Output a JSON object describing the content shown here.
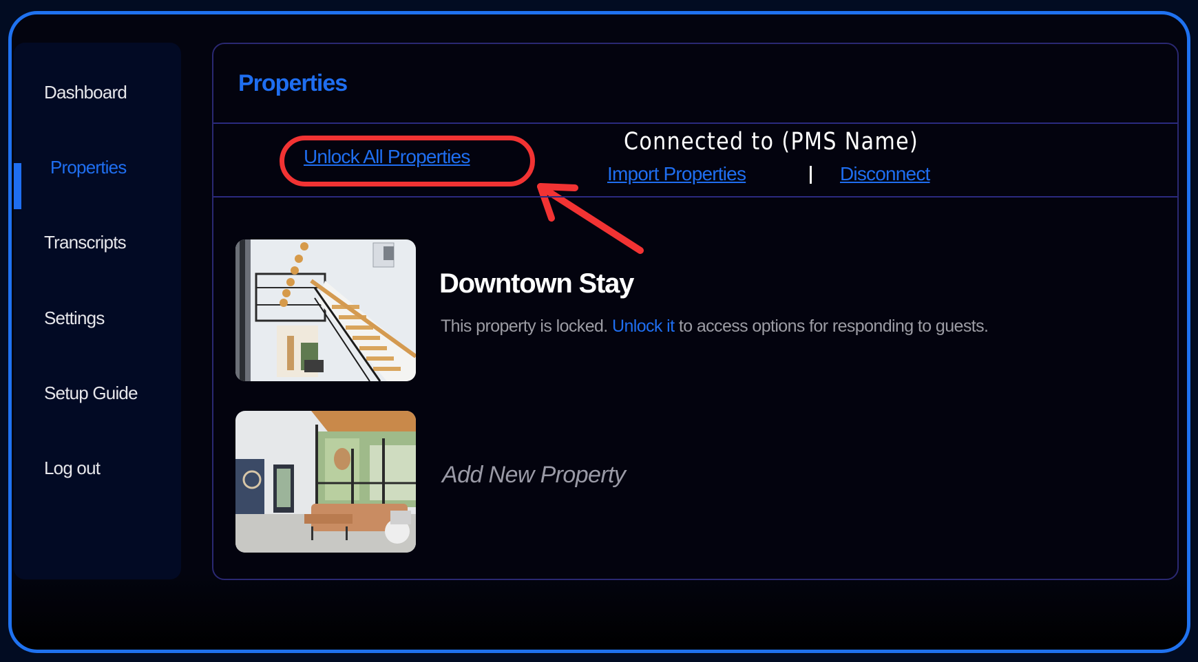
{
  "sidebar": {
    "items": [
      {
        "label": "Dashboard",
        "active": false
      },
      {
        "label": "Properties",
        "active": true
      },
      {
        "label": "Transcripts",
        "active": false
      },
      {
        "label": "Settings",
        "active": false
      },
      {
        "label": "Setup Guide",
        "active": false
      },
      {
        "label": "Log out",
        "active": false
      }
    ]
  },
  "main": {
    "title": "Properties",
    "toolbar": {
      "unlock_all_label": "Unlock All Properties",
      "connection_status": "Connected to (PMS Name)",
      "import_label": "Import Properties",
      "separator": "|",
      "disconnect_label": "Disconnect"
    },
    "properties": [
      {
        "name": "Downtown Stay",
        "status_prefix": "This property is locked.",
        "unlock_link": "Unlock it",
        "status_suffix": "to access options for responding to guests.",
        "image": "staircase-interior-photo"
      }
    ],
    "add_new": {
      "label": "Add New Property",
      "image": "living-room-interior-photo"
    }
  },
  "annotation": {
    "highlight_target": "Unlock All Properties",
    "color": "#f23333"
  },
  "colors": {
    "accent": "#1f6ef0",
    "frame_border": "#1f72f0",
    "panel_border": "#2b2a80",
    "annotation_red": "#f23333"
  }
}
